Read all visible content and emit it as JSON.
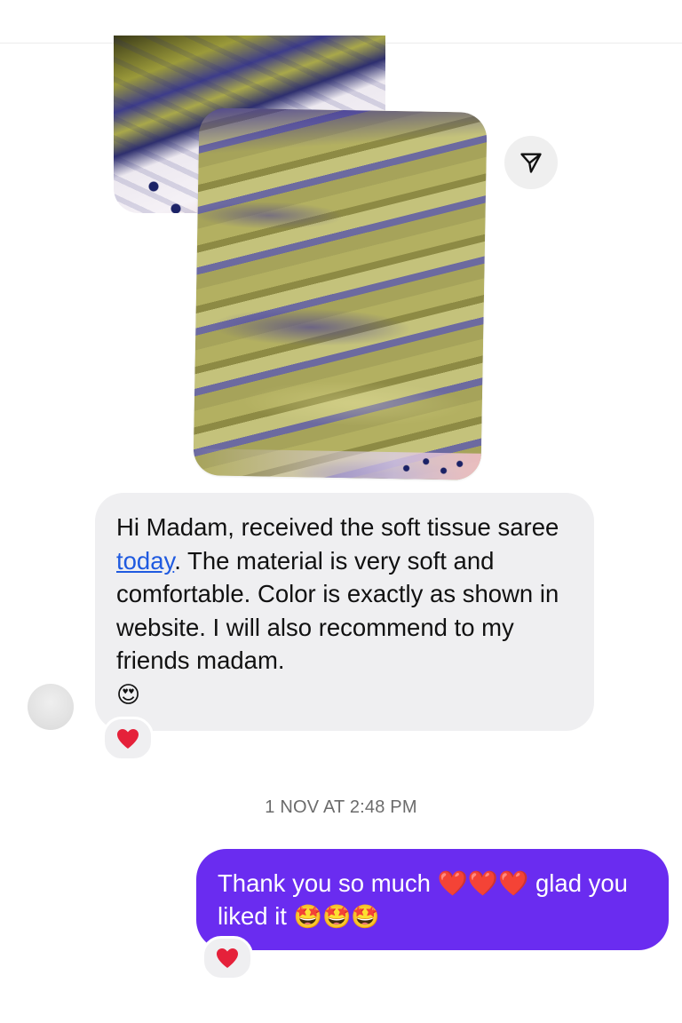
{
  "photos": [
    {
      "name": "saree-photo-back",
      "description_icon": "image"
    },
    {
      "name": "saree-photo-front",
      "description_icon": "image"
    }
  ],
  "share": {
    "icon": "share-paper-plane-icon"
  },
  "incoming": {
    "text_before_link": "Hi Madam, received the soft tissue saree ",
    "link_text": "today",
    "text_after_link": ". The material is very soft and comfortable. Color is exactly as shown in website. I will also recommend to my friends madam.",
    "emoji": "😍",
    "reaction": "❤️"
  },
  "timestamp": "1 NOV AT 2:48 PM",
  "outgoing": {
    "text_part1": "Thank you so much",
    "hearts": "❤️❤️❤️",
    "text_part2": "glad you liked it",
    "emojis": "🤩🤩🤩",
    "reaction": "❤️"
  },
  "colors": {
    "outgoing_bubble": "#6a2cf0",
    "incoming_bubble": "#efeff1",
    "link": "#1f5ae0",
    "heart": "#e5213a"
  }
}
